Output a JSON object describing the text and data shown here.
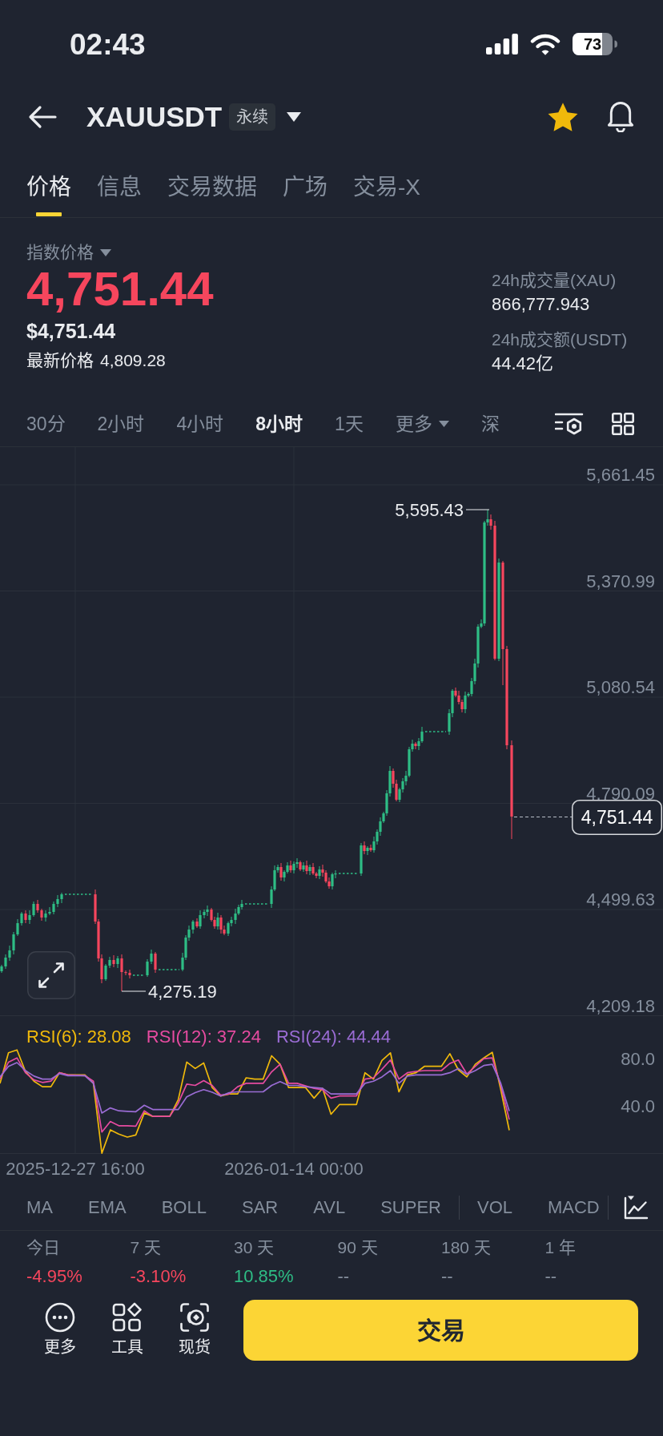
{
  "status_bar": {
    "time": "02:43",
    "battery": "73"
  },
  "header": {
    "symbol": "XAUUSDT",
    "badge": "永续",
    "favorite": true
  },
  "tabs": [
    {
      "label": "价格",
      "selected": true
    },
    {
      "label": "信息",
      "selected": false
    },
    {
      "label": "交易数据",
      "selected": false
    },
    {
      "label": "广场",
      "selected": false
    },
    {
      "label": "交易-X",
      "selected": false
    }
  ],
  "price": {
    "index_label": "指数价格",
    "index_price": "4,751.44",
    "usd_price": "$4,751.44",
    "last_label": "最新价格",
    "last_price": "4,809.28"
  },
  "stats": [
    {
      "label": "24h成交量(XAU)",
      "value": "866,777.943"
    },
    {
      "label": "24h成交额(USDT)",
      "value": "44.42亿"
    }
  ],
  "intervals": [
    {
      "label": "30分",
      "selected": false,
      "kind": "tab"
    },
    {
      "label": "2小时",
      "selected": false,
      "kind": "tab"
    },
    {
      "label": "4小时",
      "selected": false,
      "kind": "tab"
    },
    {
      "label": "8小时",
      "selected": true,
      "kind": "tab"
    },
    {
      "label": "1天",
      "selected": false,
      "kind": "tab"
    },
    {
      "label": "更多",
      "selected": false,
      "kind": "menu"
    },
    {
      "label": "深",
      "selected": false,
      "kind": "tab"
    }
  ],
  "price_chart": {
    "y_labels": [
      "5,661.45",
      "5,370.99",
      "5,080.54",
      "4,790.09",
      "4,499.63",
      "4,209.18"
    ],
    "high_label": "5,595.43",
    "low_label": "4,275.19",
    "current_price": "4,751.44"
  },
  "rsi": {
    "legend": [
      {
        "text": "RSI(6): 28.08",
        "color": "#f0b90b"
      },
      {
        "text": "RSI(12): 37.24",
        "color": "#e64ba0"
      },
      {
        "text": "RSI(24): 44.44",
        "color": "#9a6cd4"
      }
    ],
    "axis_labels": [
      "80.0",
      "40.0"
    ]
  },
  "time_axis": [
    "2025-12-27 16:00",
    "2026-01-14 00:00"
  ],
  "indicators": {
    "main": [
      "MA",
      "EMA",
      "BOLL",
      "SAR",
      "AVL",
      "SUPER"
    ],
    "sub": [
      "VOL",
      "MACD"
    ]
  },
  "periods": [
    {
      "label": "今日",
      "value": "-4.95%",
      "color": "#f6465d"
    },
    {
      "label": "7 天",
      "value": "-3.10%",
      "color": "#f6465d"
    },
    {
      "label": "30 天",
      "value": "10.85%",
      "color": "#2ebd85"
    },
    {
      "label": "90 天",
      "value": "--",
      "color": "#848e9c"
    },
    {
      "label": "180 天",
      "value": "--",
      "color": "#848e9c"
    },
    {
      "label": "1 年",
      "value": "--",
      "color": "#848e9c"
    }
  ],
  "actions": [
    {
      "label": "更多"
    },
    {
      "label": "工具"
    },
    {
      "label": "现货"
    }
  ],
  "trade_button": {
    "label": "交易"
  }
}
